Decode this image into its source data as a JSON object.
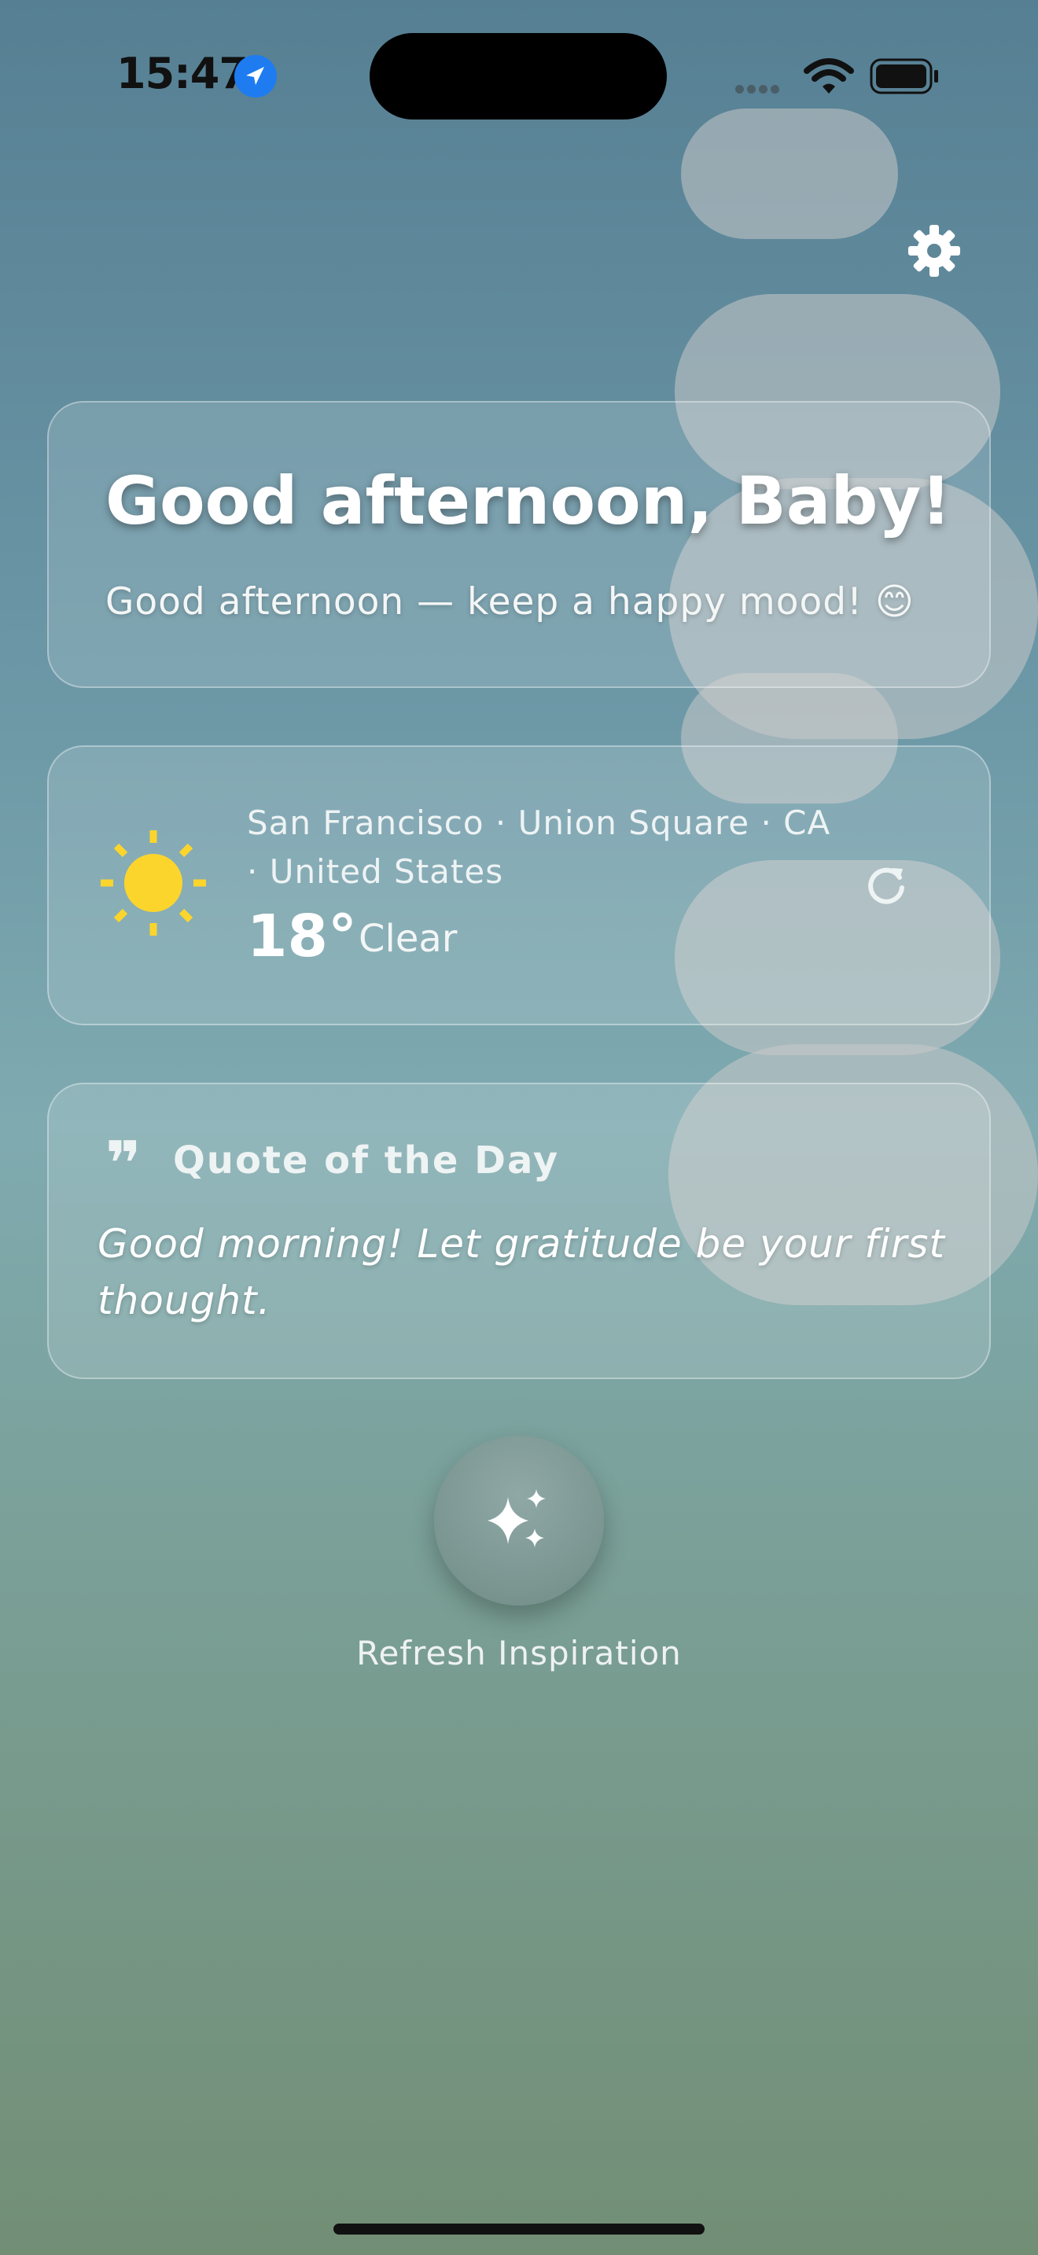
{
  "status_bar": {
    "time": "15:47",
    "location_icon": "location-arrow-icon",
    "wifi_icon": "wifi-icon",
    "battery_icon": "battery-icon"
  },
  "header": {
    "settings_icon": "gear-icon"
  },
  "greeting": {
    "title": "Good afternoon, Baby!",
    "subtitle": "Good afternoon — keep a happy mood! 😊"
  },
  "weather": {
    "icon": "sun-icon",
    "location_line1": "San Francisco · Union Square · CA",
    "location_line2": "· United States",
    "temperature": "18°",
    "condition": "Clear",
    "refresh_icon": "refresh-icon"
  },
  "quote": {
    "mark": "❞",
    "title": "Quote of the Day",
    "text": "Good morning! Let gratitude be your first thought."
  },
  "action": {
    "icon": "sparkles-icon",
    "label": "Refresh Inspiration"
  },
  "colors": {
    "accent_blue": "#1e7cf0",
    "sun_yellow": "#fcd52c",
    "bg_top": "#567f93",
    "bg_bottom": "#728e75"
  }
}
